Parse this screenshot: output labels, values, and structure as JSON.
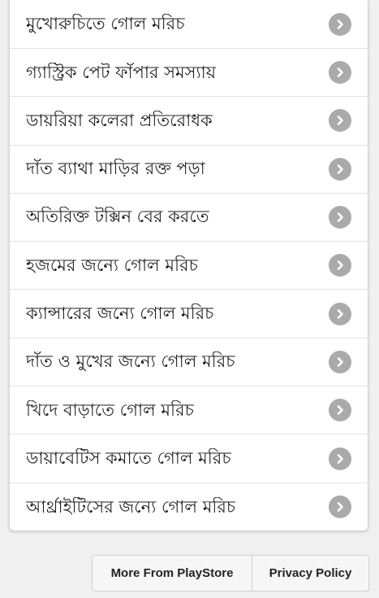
{
  "menu": {
    "items": [
      {
        "label": "মুখোরুচিতে গোল মরিচ",
        "icon": "chevron-right-icon"
      },
      {
        "label": "গ্যাস্ট্রিক পেট ফাঁপার সমস্যায়",
        "icon": "chevron-right-icon"
      },
      {
        "label": "ডায়রিয়া কলেরা প্রতিরোধক",
        "icon": "chevron-right-icon"
      },
      {
        "label": "দাঁত ব্যাথা মাড়ির রক্ত পড়া",
        "icon": "chevron-right-icon"
      },
      {
        "label": "অতিরিক্ত টক্সিন বের করতে",
        "icon": "chevron-right-icon"
      },
      {
        "label": "হজমের জন্যে গোল মরিচ",
        "icon": "chevron-right-icon"
      },
      {
        "label": "ক্যান্সারের জন্যে গোল মরিচ",
        "icon": "chevron-right-icon"
      },
      {
        "label": "দাঁত ও মুখের জন্যে গোল মরিচ",
        "icon": "chevron-right-icon"
      },
      {
        "label": "খিদে বাড়াতে গোল মরিচ",
        "icon": "chevron-right-icon"
      },
      {
        "label": "ডায়াবেটিস কমাতে গোল মরিচ",
        "icon": "chevron-right-icon"
      },
      {
        "label": "আর্থ্রাইটিসের জন্যে গোল মরিচ",
        "icon": "chevron-right-icon"
      }
    ]
  },
  "footer": {
    "more_label": "More From PlayStore",
    "privacy_label": "Privacy Policy"
  },
  "colors": {
    "background": "#f0f0f0",
    "card": "#ffffff",
    "chevron": "#aaaaaa",
    "text": "#1e1e1e"
  }
}
